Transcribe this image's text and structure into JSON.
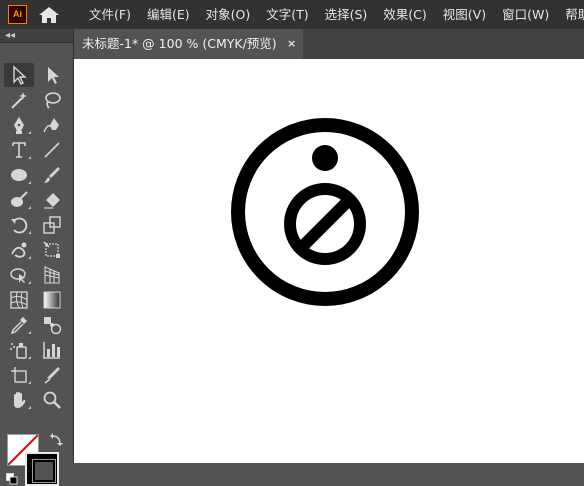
{
  "app": {
    "logo_text": "Ai",
    "logo_color": "#ff9a00"
  },
  "menu": {
    "items": [
      {
        "label": "文件(F)"
      },
      {
        "label": "编辑(E)"
      },
      {
        "label": "对象(O)"
      },
      {
        "label": "文字(T)"
      },
      {
        "label": "选择(S)"
      },
      {
        "label": "效果(C)"
      },
      {
        "label": "视图(V)"
      },
      {
        "label": "窗口(W)"
      },
      {
        "label": "帮助(H)"
      }
    ]
  },
  "toolbar": {
    "collapse_glyph": "◂◂",
    "tools": [
      {
        "name": "selection-tool",
        "selected": true
      },
      {
        "name": "direct-selection-tool"
      },
      {
        "name": "magic-wand-tool"
      },
      {
        "name": "lasso-tool"
      },
      {
        "name": "pen-tool"
      },
      {
        "name": "curvature-tool"
      },
      {
        "name": "type-tool"
      },
      {
        "name": "line-segment-tool"
      },
      {
        "name": "ellipse-tool"
      },
      {
        "name": "paintbrush-tool"
      },
      {
        "name": "shaper-tool"
      },
      {
        "name": "eraser-tool"
      },
      {
        "name": "rotate-tool"
      },
      {
        "name": "scale-tool"
      },
      {
        "name": "warp-tool"
      },
      {
        "name": "free-transform-tool"
      },
      {
        "name": "shape-builder-tool"
      },
      {
        "name": "perspective-grid-tool"
      },
      {
        "name": "mesh-tool"
      },
      {
        "name": "gradient-tool"
      },
      {
        "name": "eyedropper-tool"
      },
      {
        "name": "blend-tool"
      },
      {
        "name": "symbol-sprayer-tool"
      },
      {
        "name": "column-graph-tool"
      },
      {
        "name": "artboard-tool"
      },
      {
        "name": "slice-tool"
      },
      {
        "name": "hand-tool"
      },
      {
        "name": "zoom-tool"
      }
    ],
    "fill": "none",
    "stroke": "#000000"
  },
  "document": {
    "tab_title": "未标题-1* @ 100 % (CMYK/预览)",
    "close_glyph": "×"
  },
  "artwork": {
    "color": "#000000",
    "description_icon": "no-entry-info-icon"
  }
}
